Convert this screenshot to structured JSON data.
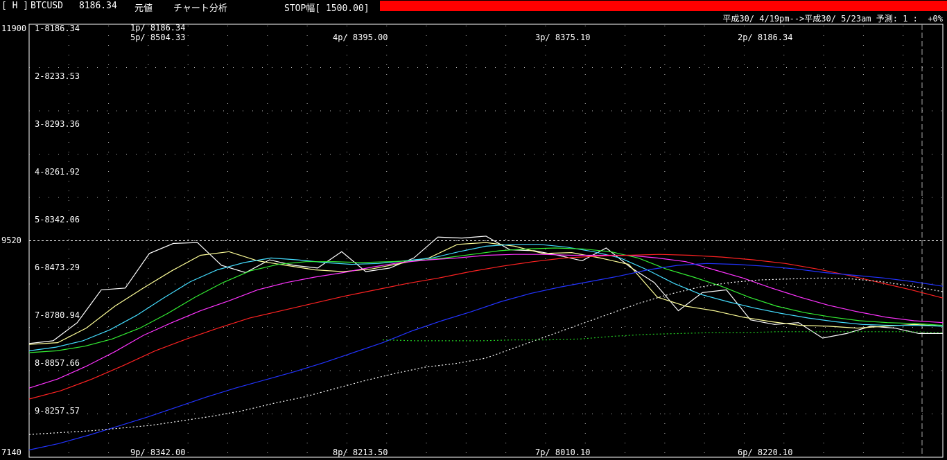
{
  "header": {
    "mode": "[ H ]",
    "symbol": "BTCUSD",
    "price": "8186.34",
    "menu1": "元値",
    "menu2": "チャート分析",
    "stop": "STOP幅[ 1500.00]"
  },
  "subheader": {
    "range": "平成30/ 4/19pm-->平成30/ 5/23am 予測: 1 :  +0%"
  },
  "colors": {
    "white": "#ffffff",
    "yellow": "#ffff99",
    "cyan": "#44ddff",
    "green": "#33ee33",
    "magenta": "#ff33ff",
    "red": "#ff2222",
    "blue": "#2233ff",
    "dotwhite": "#ffffff",
    "dotgreen": "#22cc22",
    "grid": "#bbbbbb",
    "accent": "#ff0000"
  },
  "chart_data": {
    "type": "line",
    "ylim": [
      7140,
      11900
    ],
    "yticks": [
      "11900",
      "9520",
      "7140"
    ],
    "row_labels": [
      "1-8186.34",
      "2-8233.53",
      "3-8293.36",
      "4-8261.92",
      "5-8342.06",
      "6-8473.29",
      "7-8780.94",
      "8-8857.66",
      "9-8257.57"
    ],
    "top_labels": [
      "1p/ 8186.34",
      "5p/ 8504.33",
      "4p/ 8395.00",
      "3p/ 8375.10",
      "2p/ 8186.34"
    ],
    "bottom_labels": [
      "9p/ 8342.00",
      "8p/ 8213.50",
      "7p/ 8010.10",
      "6p/ 8220.10"
    ],
    "series": [
      {
        "color": "white",
        "dash": false,
        "values": [
          8390,
          8420,
          8620,
          8980,
          9000,
          9380,
          9490,
          9500,
          9250,
          9170,
          9310,
          9250,
          9220,
          9400,
          9180,
          9220,
          9330,
          9560,
          9550,
          9570,
          9420,
          9410,
          9360,
          9300,
          9440,
          9230,
          9060,
          8750,
          8950,
          8980,
          8650,
          8600,
          8620,
          8450,
          8500,
          8580,
          8560,
          8500,
          8500
        ]
      },
      {
        "color": "yellow",
        "dash": false,
        "values": [
          8380,
          8400,
          8560,
          8800,
          9000,
          9190,
          9360,
          9400,
          9300,
          9250,
          9200,
          9180,
          9210,
          9270,
          9330,
          9480,
          9500,
          9460,
          9380,
          9390,
          9330,
          9260,
          8900,
          8800,
          8750,
          8680,
          8630,
          8590,
          8580,
          8560,
          8580,
          8600,
          8580
        ]
      },
      {
        "color": "cyan",
        "dash": false,
        "values": [
          8310,
          8350,
          8420,
          8540,
          8700,
          8890,
          9070,
          9200,
          9280,
          9330,
          9310,
          9280,
          9260,
          9270,
          9300,
          9330,
          9400,
          9460,
          9480,
          9480,
          9450,
          9400,
          9330,
          9200,
          9050,
          8930,
          8850,
          8780,
          8720,
          8670,
          8630,
          8600,
          8590,
          8590,
          8580
        ]
      },
      {
        "color": "green",
        "dash": false,
        "values": [
          8290,
          8310,
          8360,
          8440,
          8560,
          8720,
          8900,
          9060,
          9190,
          9260,
          9290,
          9290,
          9280,
          9290,
          9300,
          9330,
          9370,
          9410,
          9430,
          9440,
          9430,
          9400,
          9330,
          9210,
          9120,
          9020,
          8900,
          8800,
          8730,
          8680,
          8640,
          8620,
          8610,
          8590
        ]
      },
      {
        "color": "magenta",
        "dash": false,
        "values": [
          7900,
          8000,
          8140,
          8300,
          8480,
          8620,
          8750,
          8860,
          8980,
          9060,
          9120,
          9170,
          9230,
          9280,
          9310,
          9330,
          9360,
          9370,
          9370,
          9360,
          9360,
          9360,
          9330,
          9290,
          9200,
          9110,
          9000,
          8900,
          8810,
          8740,
          8680,
          8640,
          8620
        ]
      },
      {
        "color": "red",
        "dash": false,
        "values": [
          7780,
          7870,
          8000,
          8150,
          8310,
          8440,
          8560,
          8670,
          8750,
          8830,
          8910,
          8980,
          9050,
          9110,
          9180,
          9240,
          9290,
          9330,
          9350,
          9360,
          9370,
          9360,
          9340,
          9310,
          9270,
          9210,
          9140,
          9060,
          8980,
          8890
        ]
      },
      {
        "color": "blue",
        "dash": false,
        "values": [
          7220,
          7290,
          7380,
          7480,
          7580,
          7690,
          7800,
          7900,
          7990,
          8080,
          8180,
          8290,
          8400,
          8530,
          8640,
          8740,
          8850,
          8940,
          9010,
          9070,
          9130,
          9200,
          9250,
          9270,
          9260,
          9240,
          9210,
          9170,
          9140,
          9110,
          9070,
          9020
        ]
      },
      {
        "color": "dotwhite",
        "dash": true,
        "values": [
          7390,
          7410,
          7430,
          7460,
          7490,
          7540,
          7590,
          7650,
          7730,
          7800,
          7890,
          7980,
          8060,
          8130,
          8170,
          8230,
          8350,
          8470,
          8590,
          8710,
          8830,
          8930,
          9010,
          9060,
          9090,
          9100,
          9110,
          9100,
          9070,
          9020,
          8960
        ]
      },
      {
        "color": "dotgreen",
        "dash": true,
        "values": [
          8430,
          8420,
          8420,
          8420,
          8430,
          8430,
          8440,
          8470,
          8490,
          8500,
          8510,
          8510,
          8520,
          8520,
          8520,
          8520,
          8520,
          8510
        ]
      }
    ]
  }
}
